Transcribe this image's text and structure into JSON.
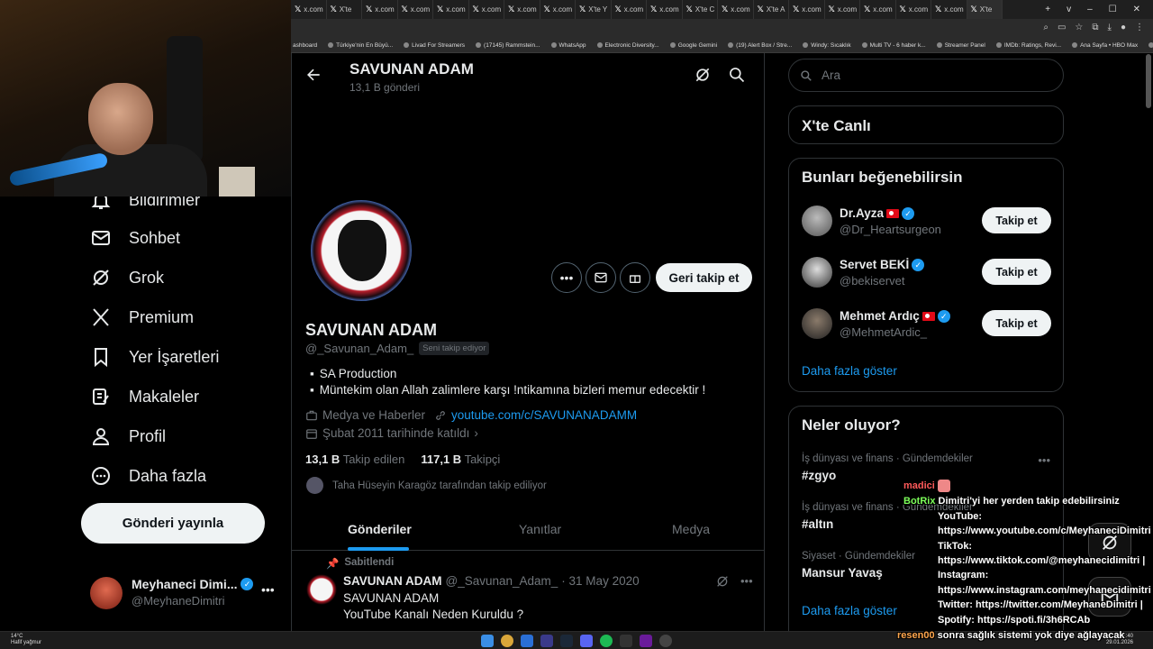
{
  "browser": {
    "tabs": [
      "x.com",
      "X'te",
      "x.com",
      "x.com",
      "x.com",
      "x.com",
      "x.com",
      "x.com",
      "X'te Y",
      "x.com",
      "x.com",
      "X'te C",
      "x.com",
      "X'te A",
      "x.com",
      "x.com",
      "x.com",
      "x.com",
      "x.com",
      "X'te"
    ],
    "window_controls": [
      "+",
      "v",
      "–",
      "☐",
      "✕"
    ],
    "bookmarks": [
      "ashboard",
      "Türkiye'nin En Büyü...",
      "Livad For Streamers",
      "(17145) Rammstein...",
      "WhatsApp",
      "Electronic Diversity...",
      "Google Gemini",
      "(19) Alert Box / Stre...",
      "Windy: Sıcaklık",
      "Multi TV - 6 haber k...",
      "Streamer Panel",
      "IMDb: Ratings, Revi...",
      "Ana Sayfa • HBO Max",
      "»",
      "Tüm Yer İşaretleri"
    ]
  },
  "sidebar": {
    "items": [
      {
        "label": "Bildirimler",
        "icon": "bell-icon"
      },
      {
        "label": "Sohbet",
        "icon": "mail-icon"
      },
      {
        "label": "Grok",
        "icon": "grok-icon"
      },
      {
        "label": "Premium",
        "icon": "x-logo-icon"
      },
      {
        "label": "Yer İşaretleri",
        "icon": "bookmark-icon"
      },
      {
        "label": "Makaleler",
        "icon": "article-icon"
      },
      {
        "label": "Profil",
        "icon": "person-icon"
      },
      {
        "label": "Daha fazla",
        "icon": "more-circle-icon"
      }
    ],
    "post_button": "Gönderi yayınla",
    "account": {
      "name": "Meyhaneci Dimi...",
      "handle": "@MeyhaneDimitri",
      "more": "•••"
    }
  },
  "profile": {
    "header_title": "SAVUNAN ADAM",
    "header_count": "13,1 B gönderi",
    "name": "SAVUNAN ADAM",
    "handle": "@_Savunan_Adam_",
    "follows_you": "Seni takip ediyor",
    "follow_back": "Geri takip et",
    "bio": [
      "SA Production",
      "Müntekim olan Allah zalimlere karşı !ntikamına bizleri memur edecektir !"
    ],
    "category": "Medya ve Haberler",
    "link": "youtube.com/c/SAVUNANADAMM",
    "joined": "Şubat 2011 tarihinde katıldı",
    "following_count": "13,1 B",
    "following_label": "Takip edilen",
    "followers_count": "117,1 B",
    "followers_label": "Takipçi",
    "followed_by": "Taha Hüseyin Karagöz tarafından takip ediliyor",
    "tabs": [
      "Gönderiler",
      "Yanıtlar",
      "Medya"
    ]
  },
  "pinned_post": {
    "label": "Sabitlendi",
    "name": "SAVUNAN ADAM",
    "handle": "@_Savunan_Adam_",
    "date": "· 31 May 2020",
    "lines": [
      "SAVUNAN ADAM",
      "YouTube Kanalı Neden Kuruldu ?"
    ],
    "more": "•••"
  },
  "right": {
    "search_placeholder": "Ara",
    "live_title": "X'te Canlı",
    "suggest_title": "Bunları beğenebilirsin",
    "suggestions": [
      {
        "name": "Dr.Ayza",
        "handle": "@Dr_Heartsurgeon",
        "button": "Takip et"
      },
      {
        "name": "Servet BEKİ",
        "handle": "@bekiservet",
        "button": "Takip et"
      },
      {
        "name": "Mehmet Ardıç",
        "handle": "@MehmetArdic_",
        "button": "Takip et"
      }
    ],
    "show_more": "Daha fazla göster",
    "trends_title": "Neler oluyor?",
    "trends": [
      {
        "category": "İş dünyası ve finans · Gündemdekiler",
        "name": "#zgyo"
      },
      {
        "category": "İş dünyası ve finans · Gündemdekiler",
        "name": "#altın"
      },
      {
        "category": "Siyaset · Gündemdekiler",
        "name": "Mansur Yavaş"
      }
    ],
    "trends_more": "Daha fazla göster"
  },
  "chat": [
    {
      "user": "madici",
      "text": ""
    },
    {
      "user": "BotRix",
      "text": "Dimitri'yi her yerden takip edebilirsiniz"
    },
    {
      "user": "",
      "text": "YouTube:"
    },
    {
      "user": "",
      "text": "https://www.youtube.com/c/MeyhaneciDimitri |"
    },
    {
      "user": "",
      "text": "TikTok:"
    },
    {
      "user": "",
      "text": "https://www.tiktok.com/@meyhanecidimitri |"
    },
    {
      "user": "",
      "text": "Instagram:"
    },
    {
      "user": "",
      "text": "https://www.instagram.com/meyhanecidimitri |"
    },
    {
      "user": "",
      "text": "Twitter: https://twitter.com/MeyhaneDimitri |"
    },
    {
      "user": "",
      "text": "Spotify: https://spoti.fi/3h6RCAb"
    },
    {
      "user": "resen00",
      "text": "sonra sağlık sistemi yok diye ağlayacak"
    }
  ],
  "taskbar": {
    "temp": "14°C",
    "weather": "Hafif yağmur",
    "time": "11:40",
    "date": "29.01.2026"
  }
}
